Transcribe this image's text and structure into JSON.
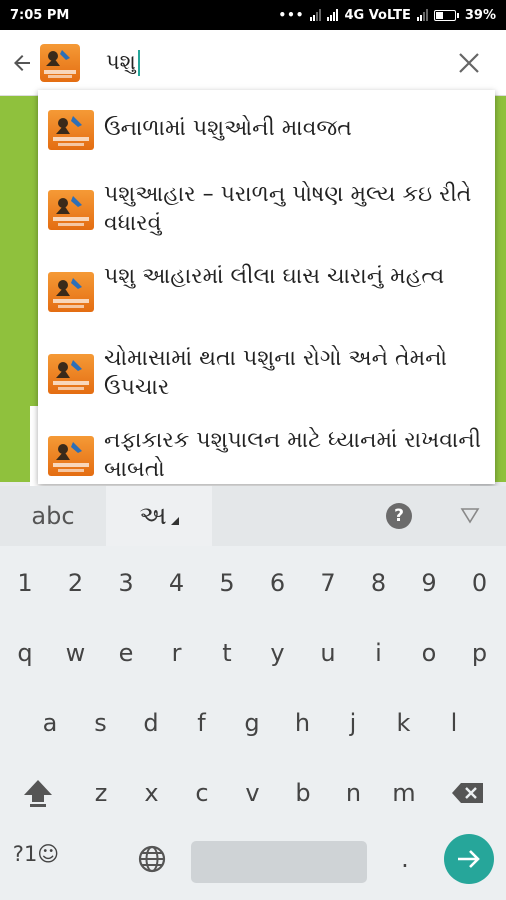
{
  "status_bar": {
    "time": "7:05 PM",
    "dots": "•••",
    "network": "4G VoLTE",
    "battery": "39%"
  },
  "toolbar": {
    "query": "પશુ"
  },
  "suggestions": [
    {
      "title": "ઉનાળામાં પશુઓની માવજત"
    },
    {
      "title": "પશુઆહાર – પરાળનુ પોષણ મુલ્ય કઇ રીતે વધારવું"
    },
    {
      "title": "પશુ આહારમાં લીલા ઘાસ ચારાનું મહત્વ"
    },
    {
      "title": "ચોમાસામાં થતા પશુના રોગો અને તેમનો ઉપચાર"
    },
    {
      "title": "નફાકારક પશુપાલન માટે ધ્યાનમાં રાખવાની બાબતો"
    }
  ],
  "keyboard": {
    "abc_label": "abc",
    "guj_label": "અ",
    "help_label": "?",
    "number_row": [
      "1",
      "2",
      "3",
      "4",
      "5",
      "6",
      "7",
      "8",
      "9",
      "0"
    ],
    "row1": [
      "q",
      "w",
      "e",
      "r",
      "t",
      "y",
      "u",
      "i",
      "o",
      "p"
    ],
    "row2": [
      "a",
      "s",
      "d",
      "f",
      "g",
      "h",
      "j",
      "k",
      "l"
    ],
    "row3": [
      "z",
      "x",
      "c",
      "v",
      "b",
      "n",
      "m"
    ],
    "symbols_label": "?1☺",
    "period": "."
  }
}
